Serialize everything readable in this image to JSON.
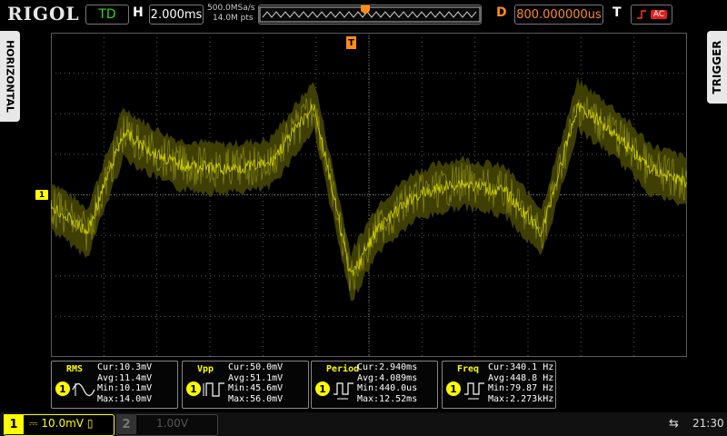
{
  "header": {
    "brand": "RIGOL",
    "run_state": "TD",
    "horizontal_label": "H",
    "timebase": "2.000ms",
    "sample_rate": "500.0MSa/s",
    "memory_depth": "14.0M pts",
    "delay_label": "D",
    "delay_value": "800.000000us",
    "trigger_label": "T",
    "trigger_source": "AC"
  },
  "side_tabs": {
    "left": "HORIZONTAL",
    "right": "TRIGGER"
  },
  "markers": {
    "channel1": "1",
    "trigger": "T"
  },
  "measurements": [
    {
      "name": "RMS",
      "channel": "1",
      "lines": [
        "Cur:10.3mV",
        "Avg:11.4mV",
        "Min:10.1mV",
        "Max:14.0mV"
      ]
    },
    {
      "name": "Vpp",
      "channel": "1",
      "lines": [
        "Cur:50.0mV",
        "Avg:51.1mV",
        "Min:45.6mV",
        "Max:56.0mV"
      ]
    },
    {
      "name": "Period",
      "channel": "1",
      "lines": [
        "Cur:2.940ms",
        "Avg:4.089ms",
        "Min:440.0us",
        "Max:12.52ms"
      ]
    },
    {
      "name": "Freq",
      "channel": "1",
      "lines": [
        "Cur:340.1 Hz",
        "Avg:448.8 Hz",
        "Min:79.87 Hz",
        "Max:2.273kHz"
      ]
    }
  ],
  "footer": {
    "ch1_number": "1",
    "ch1_scale": "10.0mV",
    "ch2_number": "2",
    "ch2_scale": "1.00V",
    "clock": "21:30"
  },
  "colors": {
    "channel1": "#ffff00",
    "trigger": "#ff8c1a",
    "run_state": "#2fd62f",
    "grid": "#5a5a5a"
  }
}
